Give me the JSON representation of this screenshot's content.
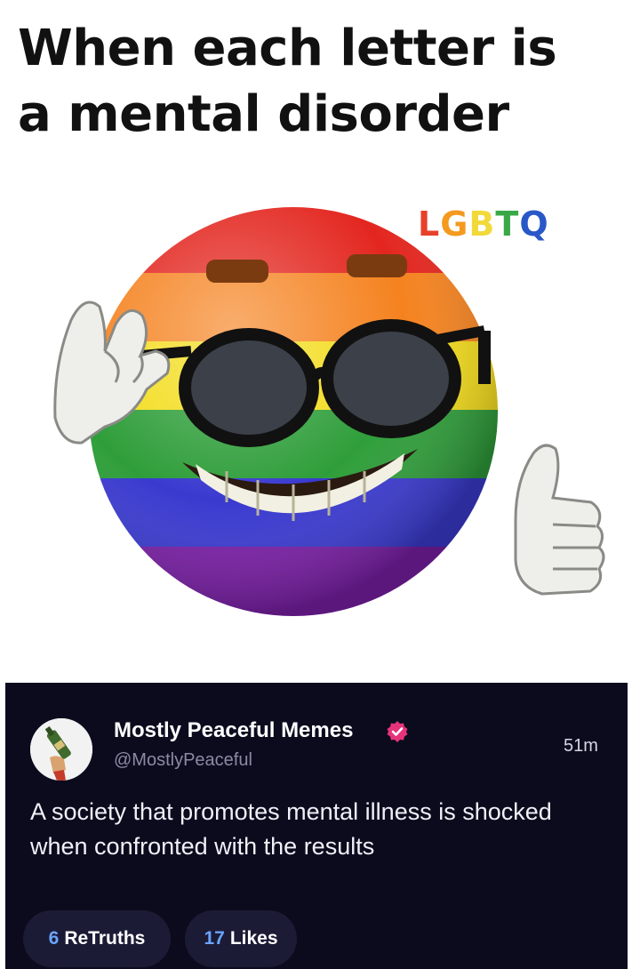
{
  "meme": {
    "title_line1": "When each letter is",
    "title_line2": "a mental disorder",
    "overlay_letters": [
      {
        "char": "L",
        "color": "#e8402a"
      },
      {
        "char": "G",
        "color": "#f39a1f"
      },
      {
        "char": "B",
        "color": "#f2d93a"
      },
      {
        "char": "T",
        "color": "#3aa847"
      },
      {
        "char": "Q",
        "color": "#2a57c8"
      }
    ],
    "image_icon": "rainbow-smiley-sunglasses-thumbs-up"
  },
  "post": {
    "author_name": "Mostly Peaceful Memes",
    "handle": "@MostlyPeaceful",
    "time": "51m",
    "verified_icon": "verified-badge-icon",
    "verified_color": "#e6337a",
    "avatar_icon": "bottle-hand-avatar",
    "text": "A society that promotes mental illness is shocked when confronted with the results",
    "retruths_count": "6",
    "retruths_label": "ReTruths",
    "likes_count": "17",
    "likes_label": "Likes",
    "accent_color": "#6aa5ff",
    "background_color": "#0c0b1e"
  }
}
